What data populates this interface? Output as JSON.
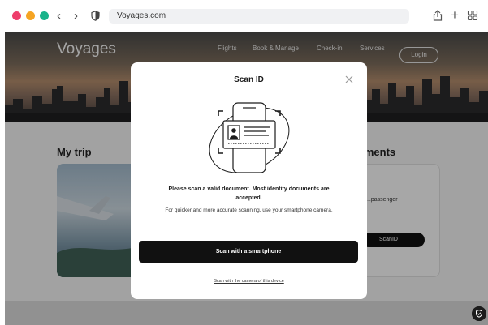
{
  "browser": {
    "url": "Voyages.com",
    "window_controls": [
      "close",
      "minimize",
      "zoom"
    ],
    "icons": [
      "back-icon",
      "forward-icon",
      "privacy-shield-icon",
      "share-icon",
      "new-tab-icon",
      "tab-overview-icon"
    ],
    "back_glyph": "‹",
    "forward_glyph": "›",
    "plus_glyph": "+",
    "colors": {
      "close": "#ee3e6b",
      "minimize": "#f5a423",
      "zoom": "#19b38a"
    }
  },
  "site": {
    "brand": "Voyages",
    "nav": [
      "Flights",
      "Book & Manage",
      "Check-in",
      "Services"
    ],
    "login_label": "Login",
    "my_trip_title": "My trip",
    "services_title": "...ments",
    "side_card_text": "...passenger",
    "side_card_button": "ScanID"
  },
  "modal": {
    "title": "Scan ID",
    "close_icon": "close-icon",
    "illustration": "phone-scanning-id-card-icon",
    "message_strong": "Please scan a valid document. Most identity documents are accepted.",
    "message_sub": "For quicker and more accurate scanning, use your smartphone camera.",
    "primary_button": "Scan with a smartphone",
    "secondary_link": "Scan with the camera of this device"
  },
  "help_icon": "shield-check-icon"
}
